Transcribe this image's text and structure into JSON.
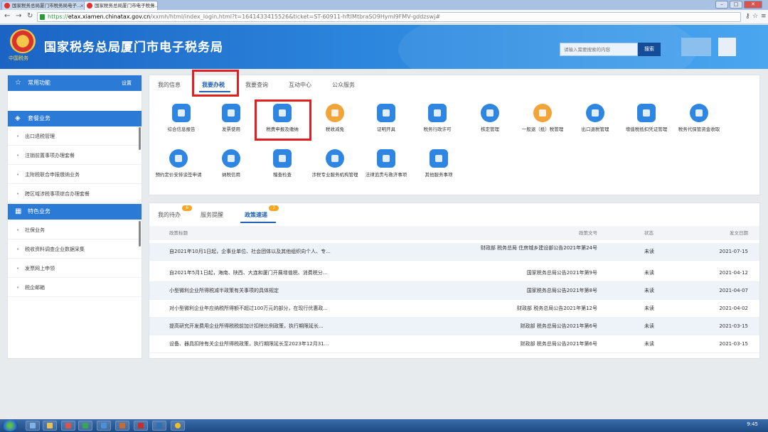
{
  "browser": {
    "tabs": [
      {
        "title": "国家税务总局厦门市税务局电子..."
      },
      {
        "title": "国家税务总局厦门市电子税务..."
      }
    ],
    "url_prefix": "https://",
    "url_host": "etax.xiamen.chinatax.gov.cn",
    "url_rest": "/xxmh/html/index_login.html?t=1641433415526&ticket=ST-60911-hftIMtbraSO9Hyml9FMV-gddzswj#"
  },
  "header": {
    "title": "国家税务总局厦门市电子税务局",
    "slogan": "中国税务",
    "search_placeholder": "请输入需要搜索的内容",
    "search_button": "搜索"
  },
  "sidebar": {
    "common": {
      "label": "常用功能",
      "setting": "设置"
    },
    "package": {
      "label": "套餐业务"
    },
    "package_items": [
      "出口退税管理",
      "注销前置事项办理套餐",
      "主附税联合申报缴纳业务",
      "跨区域涉税事项综合办理套餐"
    ],
    "special": {
      "label": "特色业务"
    },
    "special_items": [
      "社保业务",
      "税收资料调查企业数据采集",
      "发票网上申领",
      "税企邮箱"
    ]
  },
  "main_tabs": [
    "我的信息",
    "我要办税",
    "我要查询",
    "互动中心",
    "公众服务"
  ],
  "services": [
    "综合信息报告",
    "发票使用",
    "税费申报及缴纳",
    "税收减免",
    "证明开具",
    "税务行政许可",
    "核定管理",
    "一般退（抵）税管理",
    "出口退税管理",
    "增值税抵扣凭证管理",
    "税务代保管资金收取",
    "预约定价安排谈签申请",
    "纳税信用",
    "稽查检查",
    "涉税专业服务机构管理",
    "法律追责与救济事项",
    "其他服务事项"
  ],
  "bottom_tabs": [
    {
      "label": "我的待办",
      "badge": "6"
    },
    {
      "label": "服务提醒",
      "badge": ""
    },
    {
      "label": "政策速递",
      "badge": "7"
    }
  ],
  "table": {
    "headers": {
      "title": "政策标题",
      "doc": "政策文号",
      "status": "状态",
      "date": "发文日期"
    },
    "rows": [
      {
        "title": "自2021年10月1日起，企事业单位、社会团体以及其他组织向个人、专...",
        "doc": "财政部 税务总局 住房城乡建设部公告2021年第24号",
        "status": "未读",
        "date": "2021-07-15"
      },
      {
        "title": "自2021年5月1日起，海南、陕西、大连和厦门开展增值税、消费税分...",
        "doc": "国家税务总局公告2021年第9号",
        "status": "未读",
        "date": "2021-04-12"
      },
      {
        "title": "小型微利企业所得税减半政策有关事项的具体规定",
        "doc": "国家税务总局公告2021年第8号",
        "status": "未读",
        "date": "2021-04-07"
      },
      {
        "title": "对小型微利企业年应纳税所得额不超过100万元的部分，在现行优惠政...",
        "doc": "财政部 税务总局公告2021年第12号",
        "status": "未读",
        "date": "2021-04-02"
      },
      {
        "title": "提高研究开发费用企业所得税税前加计扣除比例政策，执行期限延长...",
        "doc": "财政部 税务总局公告2021年第6号",
        "status": "未读",
        "date": "2021-03-15"
      },
      {
        "title": "设备、器具扣除有关企业所得税政策，执行期限延长至2023年12月31...",
        "doc": "财政部 税务总局公告2021年第6号",
        "status": "未读",
        "date": "2021-03-15"
      }
    ]
  },
  "taskbar": {
    "clock": "9:45"
  },
  "colors": {
    "brand_blue": "#2b7ad6",
    "highlight_red": "#e02020",
    "badge_orange": "#f5a623"
  }
}
